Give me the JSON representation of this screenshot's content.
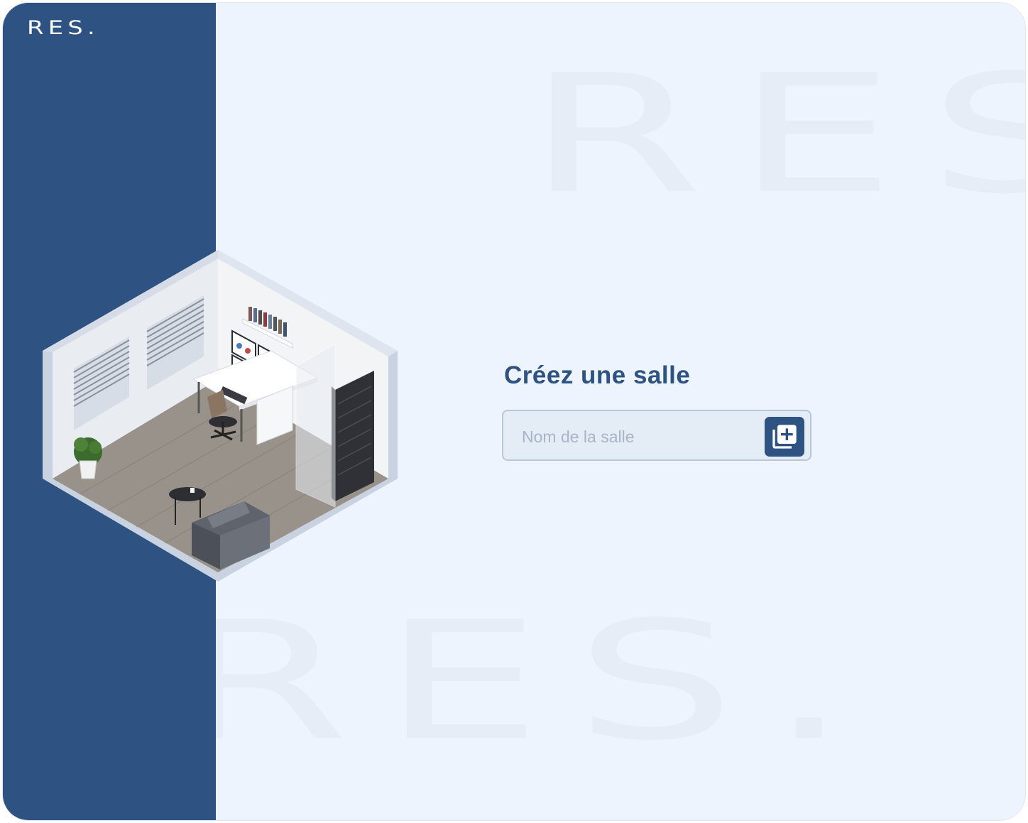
{
  "brand": {
    "logo_text": "RES.",
    "watermark_top": "RES",
    "watermark_bottom": "RES."
  },
  "form": {
    "title": "Créez une salle",
    "room_name": {
      "value": "",
      "placeholder": "Nom de la salle"
    },
    "add_button_icon": "add-to-library-icon"
  },
  "colors": {
    "primary": "#2e5281",
    "background": "#eef4fd",
    "input_bg": "#e4ecf6",
    "input_border": "#b7c7da",
    "placeholder": "#a6b5c7"
  }
}
